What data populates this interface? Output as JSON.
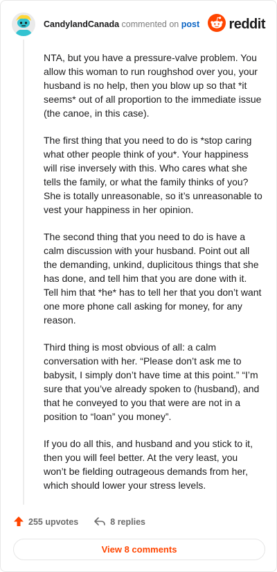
{
  "header": {
    "author": "CandylandCanada",
    "action": "commented on",
    "post_link": "post",
    "brand": "reddit"
  },
  "comment": {
    "paragraphs": [
      "NTA, but you have a pressure-valve problem. You allow this woman to run roughshod over you, your husband is no help, then you blow up so that *it seems* out of all proportion to the immediate issue (the canoe, in this case).",
      "The first thing that you need to do is *stop caring what other people think of you*. Your happiness will rise inversely with this. Who cares what she tells the family, or what the family thinks of you? She is totally unreasonable, so it’s unreasonable to vest your happiness in her opinion.",
      "The second thing that you need to do is have a calm discussion with your husband. Point out all the demanding, unkind, duplicitous things that she has done, and tell him that you are done with it. Tell him that *he* has to tell her that you don’t want one more phone call asking for money, for any reason.",
      "Third thing is most obvious of all: a calm conversation with her. “Please don’t ask me to babysit, I simply don’t have time at this point.” “I’m sure that you’ve already spoken to (husband), and that he conveyed to you that were are not in a position to “loan” you money”.",
      "If you do all this, and husband and you stick to it, then you will feel better. At the very least, you won’t be fielding outrageous demands from her, which should lower your stress levels."
    ]
  },
  "footer": {
    "upvotes": "255 upvotes",
    "replies": "8 replies",
    "view_comments": "View 8 comments"
  },
  "colors": {
    "accent": "#ff4500",
    "link": "#0a64c4",
    "avatar_bg": "#ffd635",
    "avatar_body": "#33c3d1"
  },
  "icons": {
    "avatar": "snoo-avatar-icon",
    "brand": "reddit-logo-icon",
    "upvote": "upvote-arrow-icon",
    "reply": "reply-arrow-icon"
  }
}
